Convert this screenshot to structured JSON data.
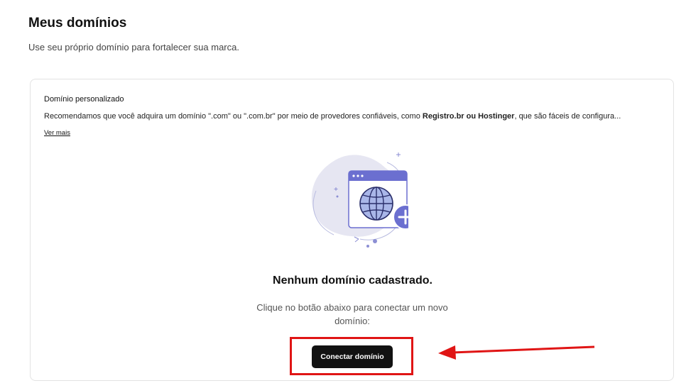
{
  "header": {
    "title": "Meus domínios",
    "subtitle": "Use seu próprio domínio para fortalecer sua marca."
  },
  "card": {
    "title": "Domínio personalizado",
    "description_prefix": "Recomendamos que você adquira um domínio \".com\" ou \".com.br\" por meio de provedores confiáveis, como ",
    "description_bold": "Registro.br ou Hostinger",
    "description_suffix": ", que são fáceis de configura...",
    "see_more": "Ver mais"
  },
  "empty_state": {
    "illustration_icon": "browser-globe-plus-icon",
    "title": "Nenhum domínio cadastrado.",
    "description": "Clique no botão abaixo para conectar um novo domínio:",
    "button_label": "Conectar domínio"
  },
  "annotation": {
    "highlight_color": "#e01515",
    "arrow_color": "#e01515"
  },
  "colors": {
    "illustration_accent": "#6b6fd0",
    "illustration_light": "#dfe0f0",
    "button_bg": "#121212"
  }
}
